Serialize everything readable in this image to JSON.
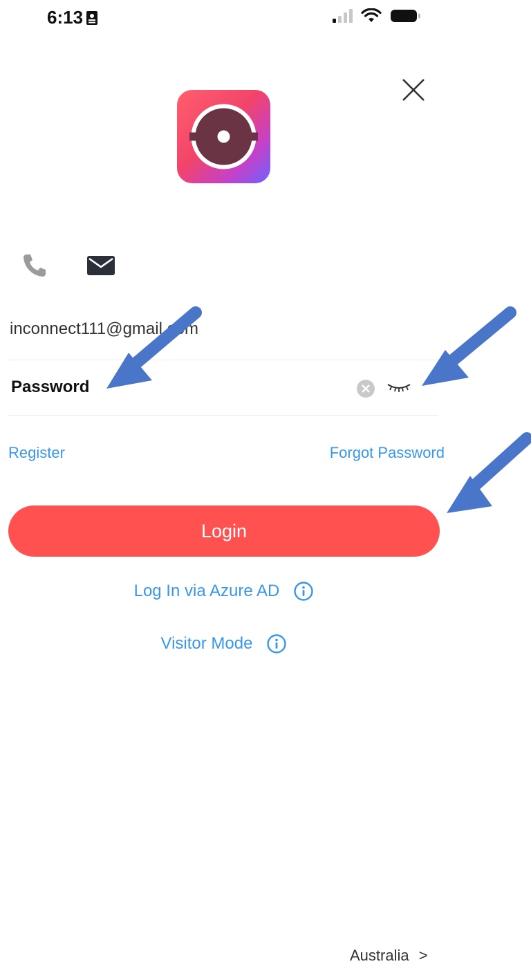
{
  "status_bar": {
    "time": "6:13"
  },
  "login": {
    "email_value": "inconnect111@gmail.com",
    "password_placeholder": "Password",
    "register_label": "Register",
    "forgot_password_label": "Forgot Password",
    "login_button_label": "Login",
    "azure_label": "Log In via Azure AD",
    "visitor_label": "Visitor Mode"
  },
  "footer": {
    "region_label": "Australia",
    "region_chevron": ">"
  },
  "icons": {
    "close": "close-icon",
    "phone": "phone-icon",
    "mail": "mail-icon",
    "clear": "clear-icon",
    "eye": "eye-closed-icon",
    "info": "info-icon"
  },
  "colors": {
    "accent_red": "#ff5150",
    "link_blue": "#3a97e8",
    "annotation_arrow": "#4a76c9"
  }
}
